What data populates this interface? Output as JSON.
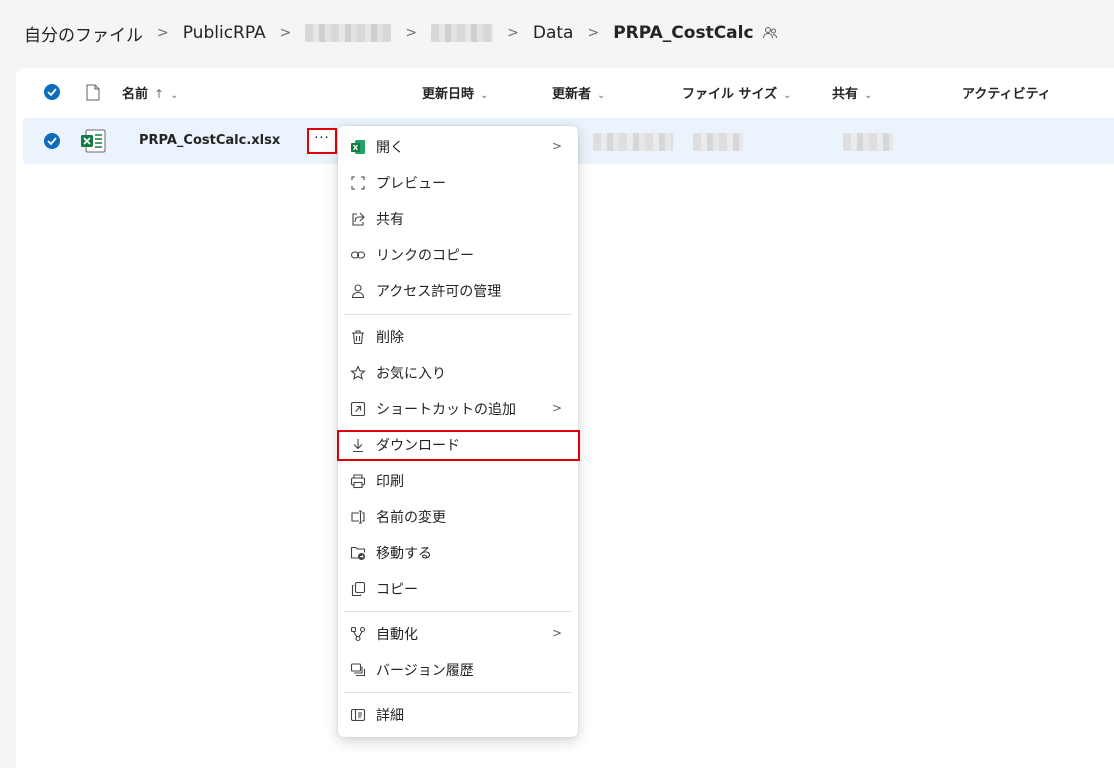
{
  "breadcrumb": {
    "root": "自分のファイル",
    "item1": "PublicRPA",
    "item4": "Data",
    "current": "PRPA_CostCalc"
  },
  "columns": {
    "name": "名前",
    "modified": "更新日時",
    "modified_by": "更新者",
    "file_size": "ファイル サイズ",
    "sharing": "共有",
    "activity": "アクティビティ"
  },
  "file": {
    "name": "PRPA_CostCalc.xlsx",
    "more_label": "···"
  },
  "menu": {
    "open": "開く",
    "preview": "プレビュー",
    "share": "共有",
    "copy_link": "リンクのコピー",
    "manage_access": "アクセス許可の管理",
    "delete": "削除",
    "favorite": "お気に入り",
    "add_shortcut": "ショートカットの追加",
    "download": "ダウンロード",
    "print": "印刷",
    "rename": "名前の変更",
    "move": "移動する",
    "copy": "コピー",
    "automate": "自動化",
    "version_history": "バージョン履歴",
    "details": "詳細"
  },
  "colors": {
    "accent": "#0f6cbd",
    "selected_row": "#ebf3fc",
    "highlight_border": "#e0000b",
    "excel_green": "#107c41"
  }
}
